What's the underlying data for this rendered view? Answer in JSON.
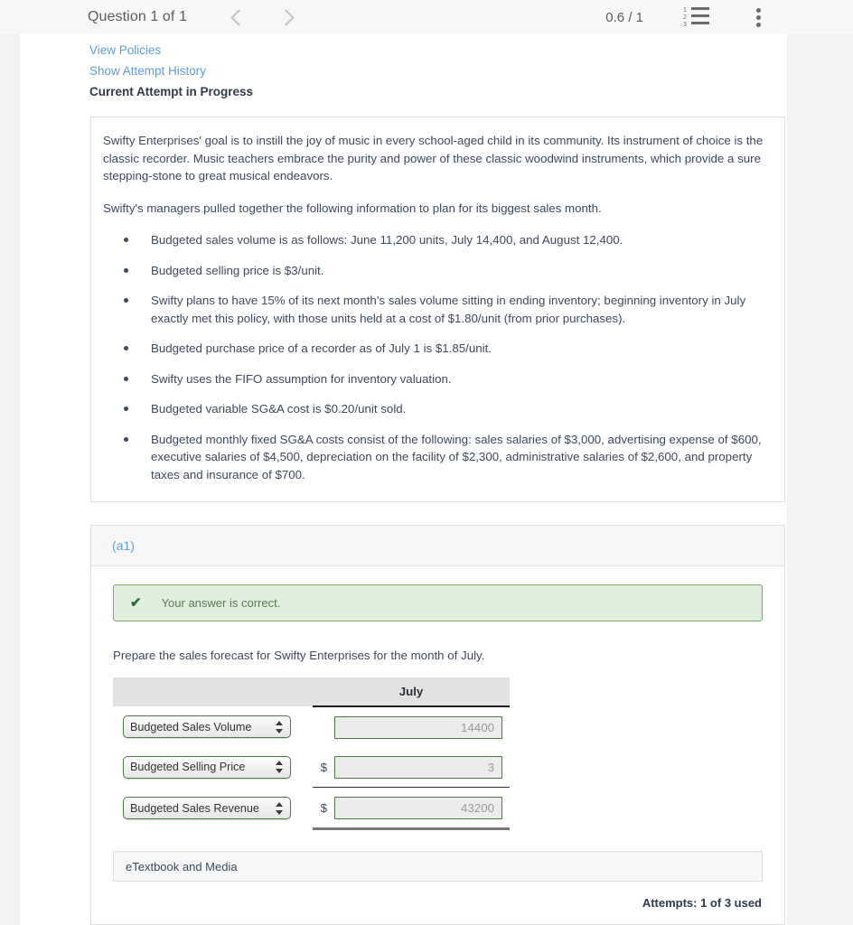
{
  "topbar": {
    "question_label": "Question 1 of 1",
    "prev_icon": "chevron-left-icon",
    "next_icon": "chevron-right-icon",
    "score": "0.6 / 1",
    "list_icon": "numbered-list-icon",
    "list_numbers": [
      "1",
      "2",
      "3"
    ],
    "menu_icon": "vertical-dots-icon"
  },
  "links": {
    "view_policies": "View Policies",
    "show_attempt_history": "Show Attempt History",
    "current_attempt": "Current Attempt in Progress"
  },
  "problem": {
    "paragraphs": [
      "Swifty Enterprises' goal is to instill the joy of music in every school-aged child in its community. Its instrument of choice is the classic recorder. Music teachers embrace the purity and power of these classic woodwind instruments, which provide a sure stepping-stone to great musical endeavors.",
      "Swifty's managers pulled together the following information to plan for its biggest sales month."
    ],
    "bullets": [
      "Budgeted sales volume is as follows: June 11,200 units, July 14,400, and August 12,400.",
      "Budgeted selling price is $3/unit.",
      "Swifty plans to have 15% of its next month's sales volume sitting in ending inventory; beginning inventory in July exactly met this policy, with those units held at a cost of $1.80/unit (from prior purchases).",
      "Budgeted purchase price of a recorder as of July 1 is $1.85/unit.",
      "Swifty uses the FIFO assumption for inventory valuation.",
      "Budgeted variable SG&A cost is $0.20/unit sold.",
      "Budgeted monthly fixed SG&A costs consist of the following: sales salaries of $3,000, advertising expense of $600, executive salaries of $4,500, depreciation on the facility of $2,300, administrative salaries of $2,600, and property taxes and insurance of $700."
    ]
  },
  "answer": {
    "part_label": "(a1)",
    "feedback_icon": "checkmark-icon",
    "feedback_text": "Your answer is correct.",
    "instruction": "Prepare the sales forecast for Swifty Enterprises for the month of July.",
    "table": {
      "blank_header": "",
      "month_header": "July",
      "rows": [
        {
          "account": "Budgeted Sales Volume",
          "currency": "",
          "value": "14400"
        },
        {
          "account": "Budgeted Selling Price",
          "currency": "$",
          "value": "3"
        },
        {
          "account": "Budgeted Sales Revenue",
          "currency": "$",
          "value": "43200"
        }
      ]
    },
    "etextbook_label": "eTextbook and Media",
    "attempts_label": "Attempts: 1 of 3 used"
  },
  "colors": {
    "link": "#5f9ddb",
    "text": "#3d4a5c",
    "success_border": "#7aa86f",
    "success_bg": "#dfeedd",
    "success_text": "#5a7a55",
    "field_border": "#4d7a43",
    "header_bg": "#e2e2e2",
    "page_bg": "#f2f2f2"
  }
}
